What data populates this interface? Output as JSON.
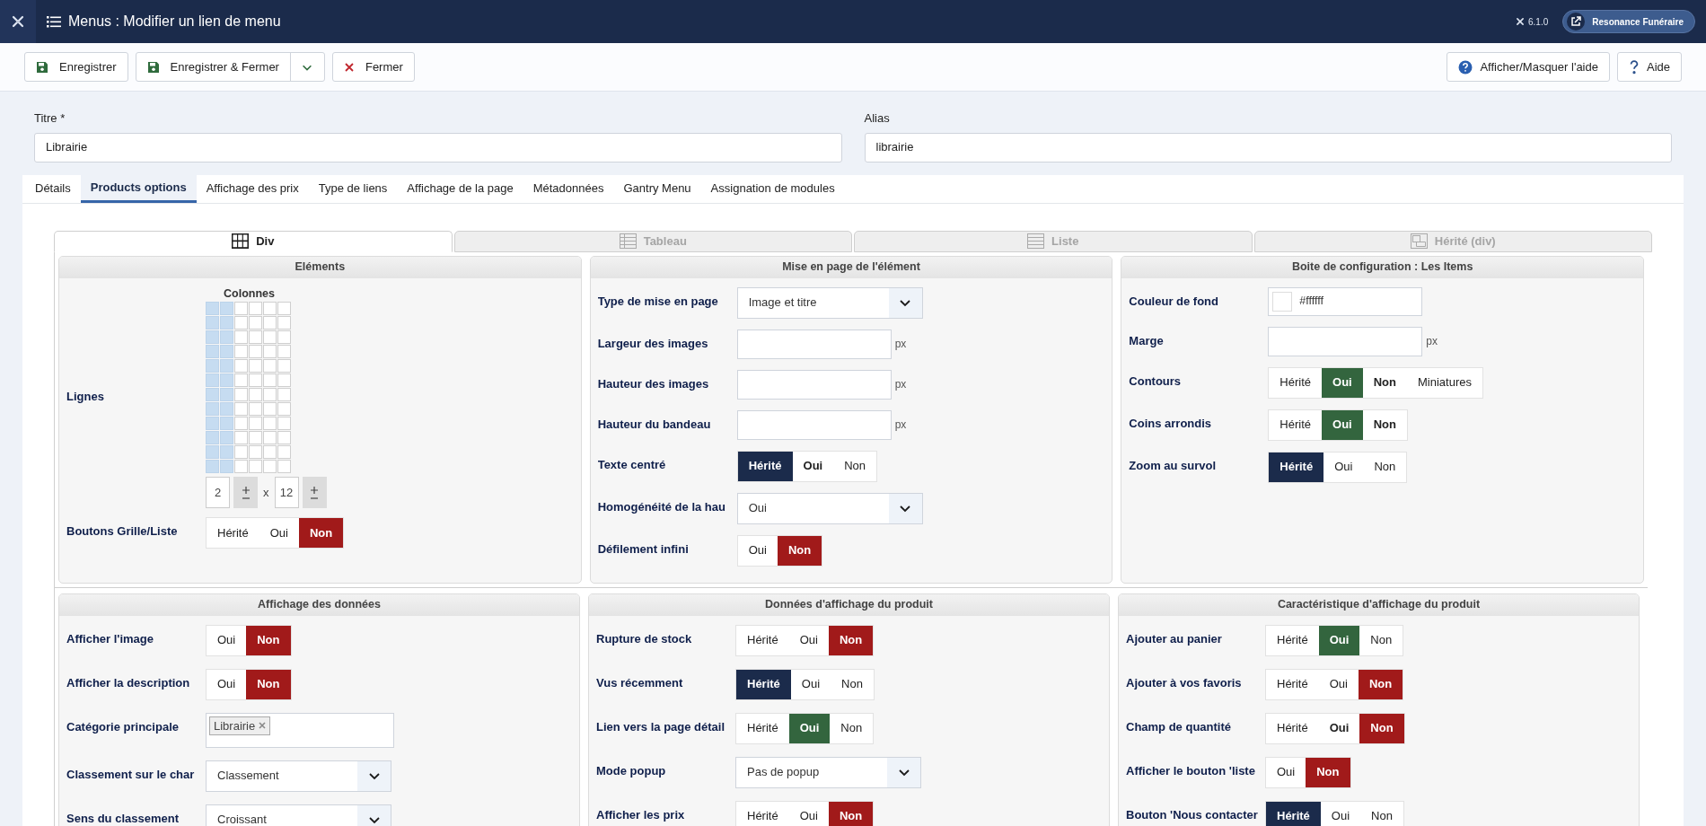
{
  "header": {
    "title": "Menus : Modifier un lien de menu",
    "version": "6.1.0",
    "site_button": "Resonance Funéraire"
  },
  "toolbar": {
    "left": [
      {
        "label": "Enregistrer",
        "kind": "save",
        "dropdown": false
      },
      {
        "label": "Enregistrer & Fermer",
        "kind": "save",
        "dropdown": true
      },
      {
        "label": "Fermer",
        "kind": "close",
        "dropdown": false
      }
    ],
    "right": [
      {
        "label": "Afficher/Masquer l'aide",
        "kind": "help"
      },
      {
        "label": "Aide",
        "kind": "question"
      }
    ]
  },
  "fields": [
    {
      "label": "Titre *",
      "value": "Librairie"
    },
    {
      "label": "Alias",
      "value": "librairie"
    }
  ],
  "tabs": [
    {
      "label": "Détails",
      "selected": false
    },
    {
      "label": "Products options",
      "selected": true
    },
    {
      "label": "Affichage des prix",
      "selected": false
    },
    {
      "label": "Type de liens",
      "selected": false
    },
    {
      "label": "Affichage de la page",
      "selected": false
    },
    {
      "label": "Métadonnées",
      "selected": false
    },
    {
      "label": "Gantry Menu",
      "selected": false
    },
    {
      "label": "Assignation de modules",
      "selected": false
    }
  ],
  "layout_tabs": [
    {
      "label": "Div",
      "kind": "div",
      "selected": true
    },
    {
      "label": "Tableau",
      "kind": "table",
      "selected": false
    },
    {
      "label": "Liste",
      "kind": "list",
      "selected": false
    },
    {
      "label": "Hérité (div)",
      "kind": "inherit",
      "selected": false
    }
  ],
  "panels_top": [
    {
      "title": "Eléments",
      "rows": [
        {
          "kind": "grid",
          "label": "Lignes",
          "heading": "Colonnes",
          "columns": "2",
          "separator": "x",
          "lines": "12",
          "cells": [
            [
              {
                "selected": true
              },
              {
                "selected": true
              },
              {
                "selected": false
              },
              {
                "selected": false
              },
              {
                "selected": false
              },
              {
                "selected": false
              }
            ],
            [
              {
                "selected": true
              },
              {
                "selected": true
              },
              {
                "selected": false
              },
              {
                "selected": false
              },
              {
                "selected": false
              },
              {
                "selected": false
              }
            ],
            [
              {
                "selected": true
              },
              {
                "selected": true
              },
              {
                "selected": false
              },
              {
                "selected": false
              },
              {
                "selected": false
              },
              {
                "selected": false
              }
            ],
            [
              {
                "selected": true
              },
              {
                "selected": true
              },
              {
                "selected": false
              },
              {
                "selected": false
              },
              {
                "selected": false
              },
              {
                "selected": false
              }
            ],
            [
              {
                "selected": true
              },
              {
                "selected": true
              },
              {
                "selected": false
              },
              {
                "selected": false
              },
              {
                "selected": false
              },
              {
                "selected": false
              }
            ],
            [
              {
                "selected": true
              },
              {
                "selected": true
              },
              {
                "selected": false
              },
              {
                "selected": false
              },
              {
                "selected": false
              },
              {
                "selected": false
              }
            ],
            [
              {
                "selected": true
              },
              {
                "selected": true
              },
              {
                "selected": false
              },
              {
                "selected": false
              },
              {
                "selected": false
              },
              {
                "selected": false
              }
            ],
            [
              {
                "selected": true
              },
              {
                "selected": true
              },
              {
                "selected": false
              },
              {
                "selected": false
              },
              {
                "selected": false
              },
              {
                "selected": false
              }
            ],
            [
              {
                "selected": true
              },
              {
                "selected": true
              },
              {
                "selected": false
              },
              {
                "selected": false
              },
              {
                "selected": false
              },
              {
                "selected": false
              }
            ],
            [
              {
                "selected": true
              },
              {
                "selected": true
              },
              {
                "selected": false
              },
              {
                "selected": false
              },
              {
                "selected": false
              },
              {
                "selected": false
              }
            ],
            [
              {
                "selected": true
              },
              {
                "selected": true
              },
              {
                "selected": false
              },
              {
                "selected": false
              },
              {
                "selected": false
              },
              {
                "selected": false
              }
            ],
            [
              {
                "selected": true
              },
              {
                "selected": true
              },
              {
                "selected": false
              },
              {
                "selected": false
              },
              {
                "selected": false
              },
              {
                "selected": false
              }
            ]
          ]
        },
        {
          "kind": "toggle",
          "label": "Boutons Grille/Liste",
          "options": [
            {
              "label": "Hérité",
              "selected": false,
              "bold": false
            },
            {
              "label": "Oui",
              "selected": false,
              "bold": false
            },
            {
              "label": "Non",
              "selected": true,
              "bold": true,
              "color": "#a11a1a"
            }
          ]
        }
      ]
    },
    {
      "title": "Mise en page de l'élément",
      "rows": [
        {
          "kind": "select",
          "label": "Type de mise en page",
          "value": "Image et titre"
        },
        {
          "kind": "input",
          "label": "Largeur des images",
          "unit": "px"
        },
        {
          "kind": "input",
          "label": "Hauteur des images",
          "unit": "px"
        },
        {
          "kind": "input",
          "label": "Hauteur du bandeau",
          "unit": "px"
        },
        {
          "kind": "toggle",
          "label": "Texte centré",
          "options": [
            {
              "label": "Hérité",
              "selected": true,
              "bold": true,
              "color": "#1b2b4b"
            },
            {
              "label": "Oui",
              "selected": false,
              "bold": true
            },
            {
              "label": "Non",
              "selected": false,
              "bold": false
            }
          ]
        },
        {
          "kind": "select",
          "label": "Homogénéité de la hau",
          "value": "Oui"
        },
        {
          "kind": "toggle",
          "label": "Défilement infini",
          "options": [
            {
              "label": "Oui",
              "selected": false,
              "bold": false
            },
            {
              "label": "Non",
              "selected": true,
              "bold": true,
              "color": "#a11a1a"
            }
          ]
        }
      ]
    },
    {
      "title": "Boite de configuration : Les Items",
      "rows": [
        {
          "kind": "color",
          "label": "Couleur de fond",
          "value": "#ffffff"
        },
        {
          "kind": "input",
          "label": "Marge",
          "unit": "px"
        },
        {
          "kind": "toggle",
          "label": "Contours",
          "options": [
            {
              "label": "Hérité",
              "selected": false,
              "bold": false
            },
            {
              "label": "Oui",
              "selected": true,
              "bold": true,
              "color": "#33653e"
            },
            {
              "label": "Non",
              "selected": false,
              "bold": true
            },
            {
              "label": "Miniatures",
              "selected": false,
              "bold": false
            }
          ]
        },
        {
          "kind": "toggle",
          "label": "Coins arrondis",
          "options": [
            {
              "label": "Hérité",
              "selected": false,
              "bold": false
            },
            {
              "label": "Oui",
              "selected": true,
              "bold": true,
              "color": "#33653e"
            },
            {
              "label": "Non",
              "selected": false,
              "bold": true
            }
          ]
        },
        {
          "kind": "toggle",
          "label": "Zoom au survol",
          "options": [
            {
              "label": "Hérité",
              "selected": true,
              "bold": true,
              "color": "#1b2b4b"
            },
            {
              "label": "Oui",
              "selected": false,
              "bold": false
            },
            {
              "label": "Non",
              "selected": false,
              "bold": false
            }
          ]
        }
      ]
    }
  ],
  "panels_bottom": [
    {
      "title": "Affichage des données",
      "rows": [
        {
          "kind": "toggle",
          "label": "Afficher l'image",
          "options": [
            {
              "label": "Oui",
              "selected": false,
              "bold": false
            },
            {
              "label": "Non",
              "selected": true,
              "bold": true,
              "color": "#a11a1a"
            }
          ]
        },
        {
          "kind": "toggle",
          "label": "Afficher la description",
          "options": [
            {
              "label": "Oui",
              "selected": false,
              "bold": false
            },
            {
              "label": "Non",
              "selected": true,
              "bold": true,
              "color": "#a11a1a"
            }
          ]
        },
        {
          "kind": "tags",
          "label": "Catégorie principale",
          "tags": [
            "Librairie"
          ]
        },
        {
          "kind": "select",
          "label": "Classement sur le char",
          "value": "Classement"
        },
        {
          "kind": "select",
          "label": "Sens du classement",
          "value": "Croissant"
        }
      ]
    },
    {
      "title": "Données d'affichage du produit",
      "rows": [
        {
          "kind": "toggle",
          "label": "Rupture de stock",
          "options": [
            {
              "label": "Hérité",
              "selected": false,
              "bold": false
            },
            {
              "label": "Oui",
              "selected": false,
              "bold": false
            },
            {
              "label": "Non",
              "selected": true,
              "bold": true,
              "color": "#a11a1a"
            }
          ]
        },
        {
          "kind": "toggle",
          "label": "Vus récemment",
          "options": [
            {
              "label": "Hérité",
              "selected": true,
              "bold": true,
              "color": "#1b2b4b"
            },
            {
              "label": "Oui",
              "selected": false,
              "bold": false
            },
            {
              "label": "Non",
              "selected": false,
              "bold": false
            }
          ]
        },
        {
          "kind": "toggle",
          "label": "Lien vers la page détail",
          "options": [
            {
              "label": "Hérité",
              "selected": false,
              "bold": false
            },
            {
              "label": "Oui",
              "selected": true,
              "bold": true,
              "color": "#33653e"
            },
            {
              "label": "Non",
              "selected": false,
              "bold": false
            }
          ]
        },
        {
          "kind": "select",
          "label": "Mode popup",
          "value": "Pas de popup"
        },
        {
          "kind": "toggle",
          "label": "Afficher les prix",
          "options": [
            {
              "label": "Hérité",
              "selected": false,
              "bold": false
            },
            {
              "label": "Oui",
              "selected": false,
              "bold": false
            },
            {
              "label": "Non",
              "selected": true,
              "bold": true,
              "color": "#a11a1a"
            }
          ]
        }
      ]
    },
    {
      "title": "Caractéristique d'affichage du produit",
      "rows": [
        {
          "kind": "toggle",
          "label": "Ajouter au panier",
          "options": [
            {
              "label": "Hérité",
              "selected": false,
              "bold": false
            },
            {
              "label": "Oui",
              "selected": true,
              "bold": true,
              "color": "#33653e"
            },
            {
              "label": "Non",
              "selected": false,
              "bold": false
            }
          ]
        },
        {
          "kind": "toggle",
          "label": "Ajouter à vos favoris",
          "options": [
            {
              "label": "Hérité",
              "selected": false,
              "bold": false
            },
            {
              "label": "Oui",
              "selected": false,
              "bold": false
            },
            {
              "label": "Non",
              "selected": true,
              "bold": true,
              "color": "#a11a1a"
            }
          ]
        },
        {
          "kind": "toggle",
          "label": "Champ de quantité",
          "options": [
            {
              "label": "Hérité",
              "selected": false,
              "bold": false
            },
            {
              "label": "Oui",
              "selected": false,
              "bold": true
            },
            {
              "label": "Non",
              "selected": true,
              "bold": true,
              "color": "#a11a1a"
            }
          ]
        },
        {
          "kind": "toggle",
          "label": "Afficher le bouton 'liste",
          "options": [
            {
              "label": "Oui",
              "selected": false,
              "bold": false
            },
            {
              "label": "Non",
              "selected": true,
              "bold": true,
              "color": "#a11a1a"
            }
          ]
        },
        {
          "kind": "toggle",
          "label": "Bouton 'Nous contacter",
          "options": [
            {
              "label": "Hérité",
              "selected": true,
              "bold": true,
              "color": "#1b2b4b"
            },
            {
              "label": "Oui",
              "selected": false,
              "bold": false
            },
            {
              "label": "Non",
              "selected": false,
              "bold": false
            }
          ]
        }
      ]
    }
  ]
}
